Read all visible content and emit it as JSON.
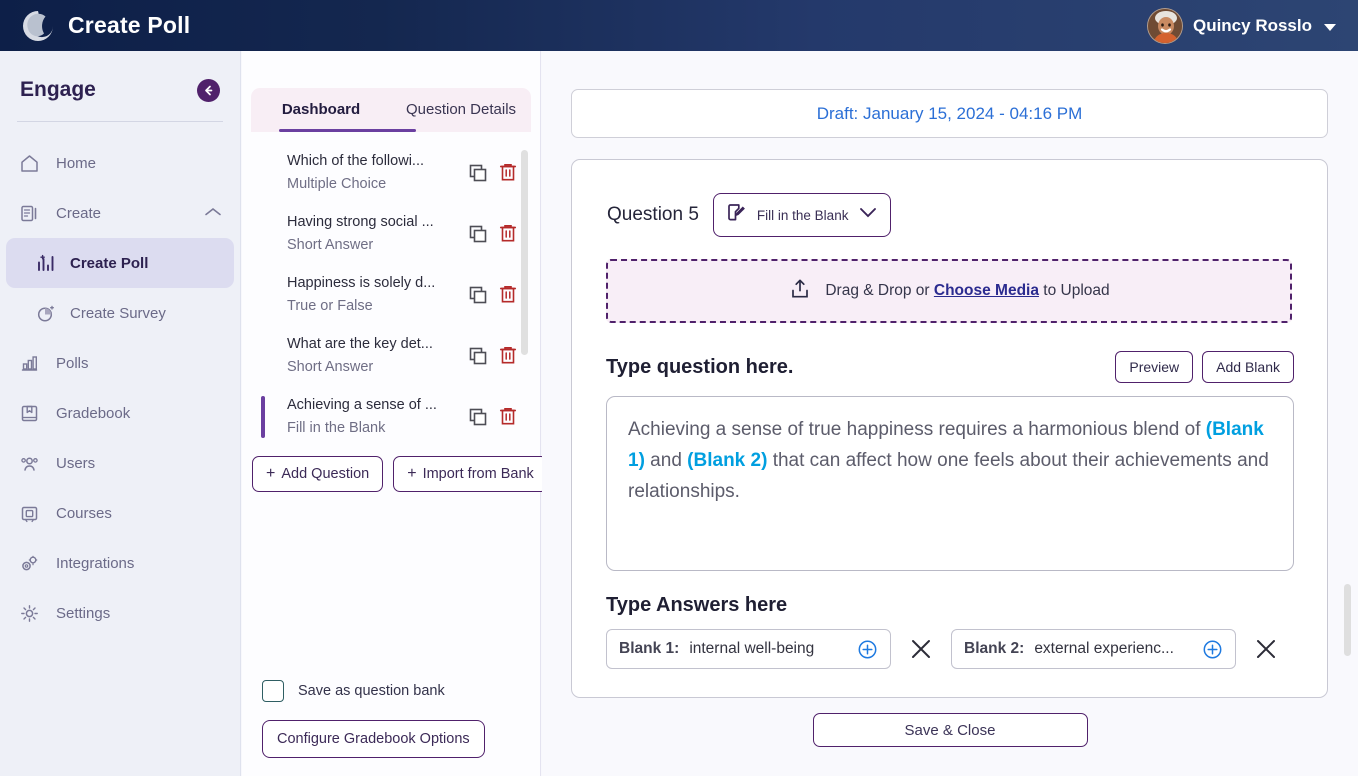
{
  "header": {
    "app_title": "Create Poll",
    "logo_icon": "swirl-logo-icon",
    "user_name": "Quincy Rosslo",
    "avatar_icon": "user-avatar",
    "caret_icon": "chevron-down-icon",
    "bg_color": "#14274f"
  },
  "sidebar": {
    "brand": "Engage",
    "collapse_icon": "arrow-left-circle-icon",
    "accent_color": "#50216b",
    "items": [
      {
        "label": "Home",
        "icon": "home-icon",
        "active": false,
        "sub": false
      },
      {
        "label": "Create",
        "icon": "create-document-icon",
        "active": false,
        "sub": false,
        "expanded": true,
        "chevron": "chevron-up-icon"
      },
      {
        "label": "Create Poll",
        "icon": "poll-bar-chart-icon",
        "active": true,
        "sub": true
      },
      {
        "label": "Create Survey",
        "icon": "survey-pie-icon",
        "active": false,
        "sub": true
      },
      {
        "label": "Polls",
        "icon": "bar-chart-icon",
        "active": false,
        "sub": false
      },
      {
        "label": "Gradebook",
        "icon": "book-bookmark-icon",
        "active": false,
        "sub": false
      },
      {
        "label": "Users",
        "icon": "users-icon",
        "active": false,
        "sub": false
      },
      {
        "label": "Courses",
        "icon": "courses-frame-icon",
        "active": false,
        "sub": false
      },
      {
        "label": "Integrations",
        "icon": "gears-icon",
        "active": false,
        "sub": false
      },
      {
        "label": "Settings",
        "icon": "gear-icon",
        "active": false,
        "sub": false
      }
    ]
  },
  "question_panel": {
    "tabs": [
      {
        "label": "Dashboard",
        "active": true
      },
      {
        "label": "Question Details",
        "active": false
      }
    ],
    "questions": [
      {
        "title": "Which of the followi...",
        "type": "Multiple Choice",
        "selected": false
      },
      {
        "title": "Having strong social ...",
        "type": "Short Answer",
        "selected": false
      },
      {
        "title": "Happiness is solely d...",
        "type": "True or False",
        "selected": false
      },
      {
        "title": "What are the key det...",
        "type": "Short Answer",
        "selected": false
      },
      {
        "title": "Achieving a sense of ...",
        "type": "Fill in the Blank",
        "selected": true
      }
    ],
    "row_icons": {
      "duplicate": "copy-icon",
      "delete": "trash-icon"
    },
    "add_question_label": "Add Question",
    "import_from_bank_label": "Import from Bank",
    "plus_glyph": "+",
    "save_as_bank_label": "Save as question bank",
    "save_as_bank_checked": false,
    "configure_gradebook_label": "Configure Gradebook Options"
  },
  "main": {
    "draft_status": "Draft: January 15, 2024 - 04:16 PM",
    "question_number_label": "Question 5",
    "question_type": "Fill in the Blank",
    "question_type_icon": "edit-pencil-square-icon",
    "question_type_caret": "chevron-down-icon",
    "upload": {
      "icon": "upload-icon",
      "prefix": "Drag & Drop or ",
      "link": "Choose Media",
      "suffix": " to Upload"
    },
    "question_prompt_label": "Type question here.",
    "preview_label": "Preview",
    "add_blank_label": "Add Blank",
    "question_text": {
      "part1": "Achieving a sense of true happiness requires a harmonious blend of ",
      "blank1": "(Blank 1)",
      "part2": " and ",
      "blank2": "(Blank 2)",
      "part3": " that can affect how one feels about their achievements and relationships."
    },
    "answers_label": "Type Answers here",
    "answers": [
      {
        "key": "Blank 1:",
        "value": "internal well-being",
        "add_icon": "plus-circle-icon",
        "remove_icon": "close-x-icon"
      },
      {
        "key": "Blank 2:",
        "value": "external experienc...",
        "add_icon": "plus-circle-icon",
        "remove_icon": "close-x-icon"
      }
    ],
    "save_close_label": "Save & Close"
  },
  "colors": {
    "header_navy": "#14274f",
    "purple_accent": "#50216b",
    "tab_underline": "#6b3fa0",
    "blank_blue": "#009fe0",
    "draft_blue": "#2b6fd6",
    "link_blue": "#2b2b8f",
    "trash_red": "#b52a2a"
  }
}
